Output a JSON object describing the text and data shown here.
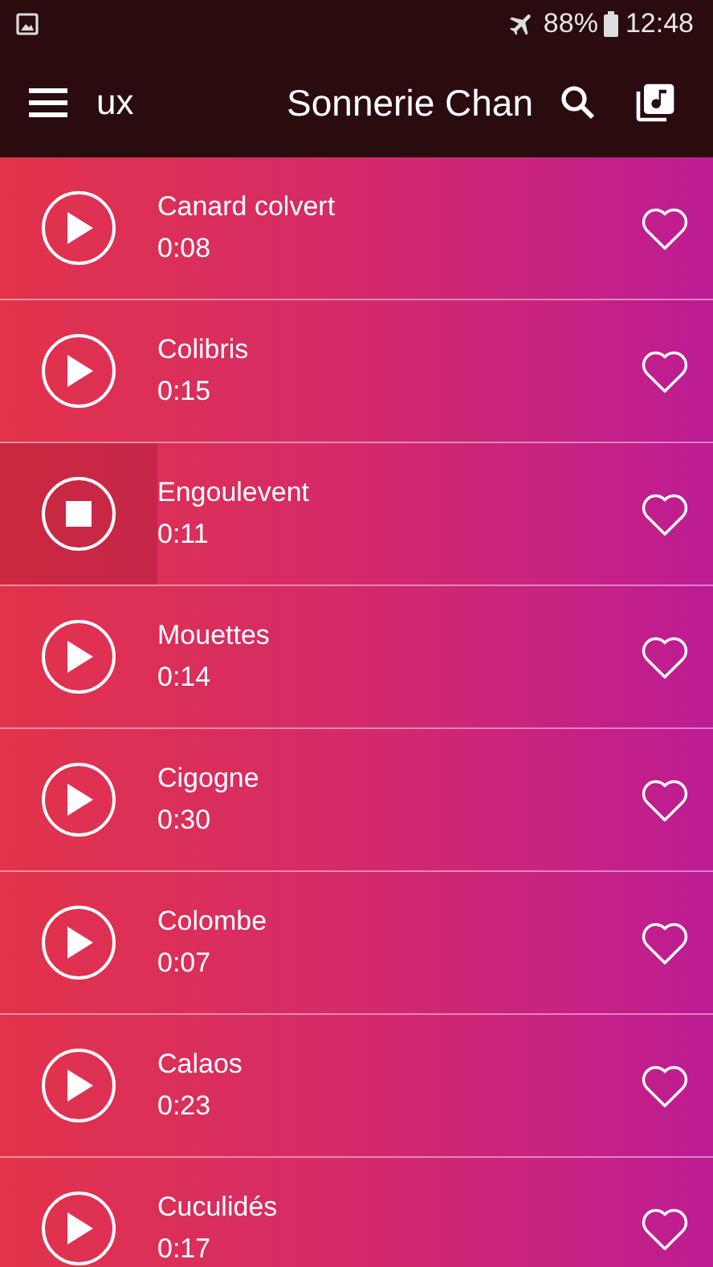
{
  "status_bar": {
    "battery": "88%",
    "time": "12:48"
  },
  "toolbar": {
    "title_tail": "ux",
    "title": "Sonnerie Chan"
  },
  "sounds": [
    {
      "name": "Canard colvert",
      "duration": "0:08",
      "playing": false,
      "favorite": false
    },
    {
      "name": "Colibris",
      "duration": "0:15",
      "playing": false,
      "favorite": false
    },
    {
      "name": "Engoulevent",
      "duration": "0:11",
      "playing": true,
      "favorite": false
    },
    {
      "name": "Mouettes",
      "duration": "0:14",
      "playing": false,
      "favorite": false
    },
    {
      "name": "Cigogne",
      "duration": "0:30",
      "playing": false,
      "favorite": false
    },
    {
      "name": "Colombe",
      "duration": "0:07",
      "playing": false,
      "favorite": false
    },
    {
      "name": "Calaos",
      "duration": "0:23",
      "playing": false,
      "favorite": false
    },
    {
      "name": "Cuculidés",
      "duration": "0:17",
      "playing": false,
      "favorite": false
    }
  ]
}
